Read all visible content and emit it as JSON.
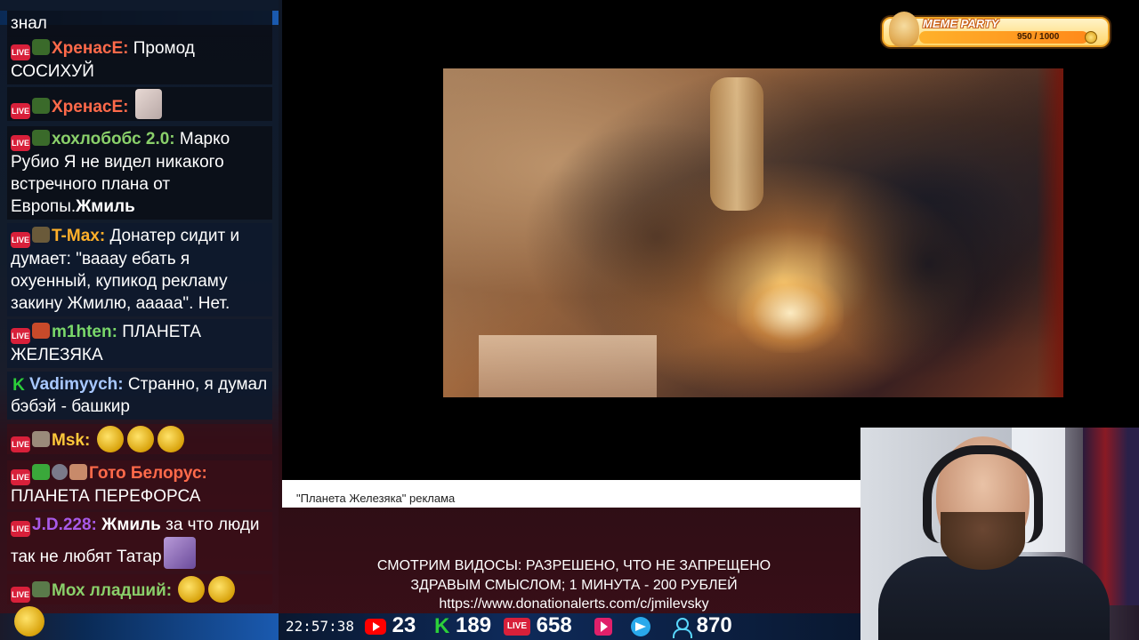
{
  "chat": {
    "messages": [
      {
        "user": "",
        "text": "знал"
      },
      {
        "user": "ХренасЕ:",
        "text": "Промод СОСИХУЙ",
        "user_color": "#ff6a4a"
      },
      {
        "user": "ХренасЕ:",
        "text": "",
        "user_color": "#ff6a4a"
      },
      {
        "user": "хохлобобс 2.0:",
        "text": "Марко Рубио Я не видел никакого встречного плана от Европы.",
        "bold_suffix": "Жмиль",
        "user_color": "#8ad06a"
      },
      {
        "user": "T-Max:",
        "text": "Донатер сидит и думает: \"вааау ебать я охуенный, купикод рекламу закину Жмилю, ааааа\". Нет.",
        "user_color": "#ffb02a"
      },
      {
        "user": "m1hten:",
        "text": "ПЛАНЕТА ЖЕЛЕЗЯКА",
        "user_color": "#7ad86a"
      },
      {
        "user": "Vadimyych:",
        "text": "Странно, я думал бэбэй - башкир",
        "user_color": "#a8c8ff"
      },
      {
        "user": "Msk:",
        "text": "",
        "user_color": "#ffc83a"
      },
      {
        "user": "Гото Белорус:",
        "text": "ПЛАНЕТА ПЕРЕФОРСА",
        "user_color": "#ff6a4a"
      },
      {
        "user": "J.D.228:",
        "text": "за что люди так не любят Татар",
        "bold_prefix": "Жмиль",
        "user_color": "#a85ae8"
      },
      {
        "user": "Мох лладший:",
        "text": "",
        "user_color": "#8ad06a"
      }
    ]
  },
  "video": {
    "caption": "\"Планета Железяка\" реклама"
  },
  "meme_party": {
    "title": "MEME PARTY",
    "progress_text": "950 / 1000",
    "progress": 0.95
  },
  "rules": {
    "line1": "СМОТРИМ ВИДОСЫ: РАЗРЕШЕНО, ЧТО НЕ ЗАПРЕЩЕНО",
    "line2": "ЗДРАВЫМ СМЫСЛОМ; 1 МИНУТА - 200 РУБЛЕЙ",
    "line3": "https://www.donationalerts.com/c/jmilevsky"
  },
  "stats": {
    "clock": "22:57:38",
    "youtube": "23",
    "kick": "189",
    "vk_live": "658",
    "viewers": "870",
    "live_label": "LIVE"
  },
  "colors": {
    "live_badge": "#d8203a",
    "kick_green": "#2ccf3a",
    "youtube_red": "#ff0000",
    "telegram_blue": "#29a9eb"
  },
  "icons": [
    "live-badge",
    "kick-icon",
    "youtube-icon",
    "vk-play-icon",
    "telegram-icon",
    "viewers-icon",
    "doge-icon",
    "coin-icon"
  ]
}
